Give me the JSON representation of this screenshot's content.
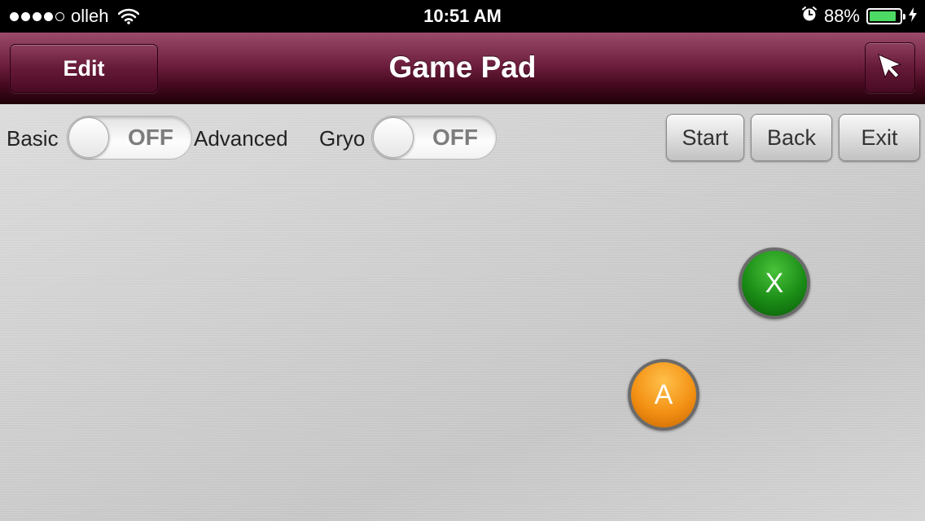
{
  "status_bar": {
    "signal_bars": 4,
    "signal_total": 5,
    "carrier": "olleh",
    "time": "10:51 AM",
    "battery_percent": "88%",
    "battery_level": 0.88,
    "icons": [
      "wifi-icon",
      "alarm-icon",
      "battery-icon",
      "charging-bolt-icon"
    ]
  },
  "nav_bar": {
    "title": "Game Pad",
    "edit_label": "Edit",
    "pointer_icon": "mouse-pointer-icon"
  },
  "controls": {
    "basic_label": "Basic",
    "advanced_label": "Advanced",
    "mode_toggle_state": "OFF",
    "gyro_label": "Gryo",
    "gyro_toggle_state": "OFF",
    "start_label": "Start",
    "back_label": "Back",
    "exit_label": "Exit"
  },
  "pad_buttons": {
    "x_label": "X",
    "a_label": "A"
  },
  "colors": {
    "nav_bar": "#6e1f3e",
    "x_button": "#1a8c16",
    "a_button": "#f39114",
    "battery": "#4cd964"
  }
}
